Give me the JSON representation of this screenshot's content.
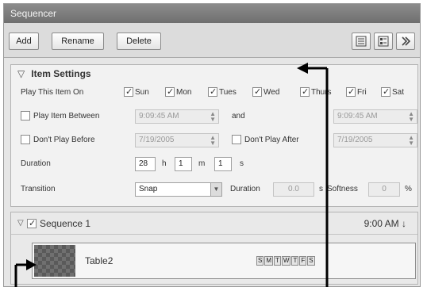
{
  "window": {
    "title": "Sequencer"
  },
  "toolbar": {
    "add_label": "Add",
    "rename_label": "Rename",
    "delete_label": "Delete"
  },
  "settings": {
    "title": "Item Settings",
    "play_on_label": "Play This Item On",
    "days": [
      {
        "label": "Sun",
        "checked": true
      },
      {
        "label": "Mon",
        "checked": true
      },
      {
        "label": "Tues",
        "checked": true
      },
      {
        "label": "Wed",
        "checked": true
      },
      {
        "label": "Thurs",
        "checked": true
      },
      {
        "label": "Fri",
        "checked": true
      },
      {
        "label": "Sat",
        "checked": true
      }
    ],
    "play_between_label": "Play Item Between",
    "between_start": "9:09:45 AM",
    "and_label": "and",
    "between_end": "9:09:45 AM",
    "dont_play_before_label": "Don't Play Before",
    "before_date": "7/19/2005",
    "dont_play_after_label": "Don't Play After",
    "after_date": "7/19/2005",
    "duration_label": "Duration",
    "duration_h": "28",
    "h_unit": "h",
    "duration_m": "1",
    "m_unit": "m",
    "duration_s": "1",
    "s_unit": "s",
    "transition_label": "Transition",
    "transition_value": "Snap",
    "trans_duration_label": "Duration",
    "trans_duration_value": "0.0",
    "trans_duration_unit": "s",
    "softness_label": "Softness",
    "softness_value": "0",
    "softness_unit": "%"
  },
  "sequence": {
    "title": "Sequence 1",
    "time": "9:00 AM",
    "sort_glyph": "↓",
    "item": {
      "title": "Table2",
      "days": [
        "S",
        "M",
        "T",
        "W",
        "T",
        "F",
        "S"
      ]
    }
  },
  "icons": [
    "expand-collapse-icon",
    "list-view-icon",
    "detail-view-icon",
    "more-icon"
  ]
}
